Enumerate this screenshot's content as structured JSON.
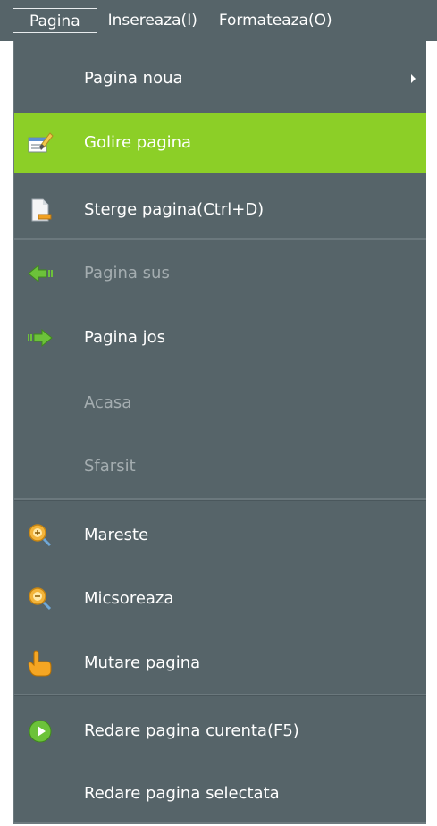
{
  "menubar": {
    "items": [
      {
        "label": "Pagina"
      },
      {
        "label": "Insereaza(I)"
      },
      {
        "label": "Formateaza(O)"
      }
    ]
  },
  "menu": {
    "items": [
      {
        "label": "Pagina noua",
        "state": "normal",
        "submenu": true
      },
      {
        "label": "Golire pagina",
        "state": "highlighted",
        "icon": "clear-page-icon"
      },
      {
        "label": "Sterge pagina(Ctrl+D)",
        "state": "normal",
        "icon": "delete-page-icon"
      },
      {
        "label": "Pagina sus",
        "state": "disabled",
        "icon": "arrow-left-icon"
      },
      {
        "label": "Pagina jos",
        "state": "normal",
        "icon": "arrow-right-icon"
      },
      {
        "label": "Acasa",
        "state": "disabled"
      },
      {
        "label": "Sfarsit",
        "state": "disabled"
      },
      {
        "label": "Mareste",
        "state": "normal",
        "icon": "zoom-in-icon"
      },
      {
        "label": "Micsoreaza",
        "state": "normal",
        "icon": "zoom-out-icon"
      },
      {
        "label": "Mutare pagina",
        "state": "normal",
        "icon": "hand-pointer-icon"
      },
      {
        "label": "Redare pagina curenta(F5)",
        "state": "normal",
        "icon": "play-icon"
      },
      {
        "label": "Redare pagina selectata",
        "state": "normal"
      }
    ]
  },
  "colors": {
    "menu_background": "#566469",
    "highlight": "#8ccf27",
    "text": "#ffffff",
    "disabled_text": "#a4adb0"
  }
}
